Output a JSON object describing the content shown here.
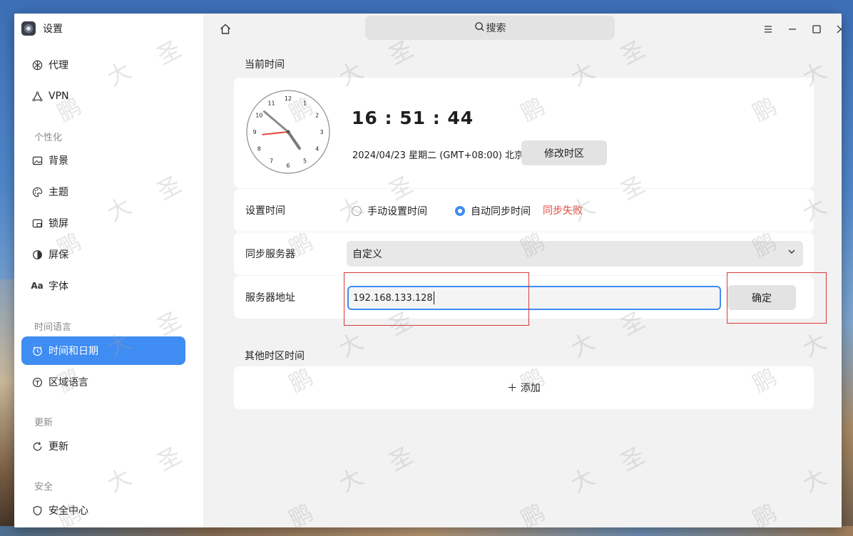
{
  "app": {
    "title": "设置"
  },
  "sidebar": {
    "items": [
      {
        "label": "代理",
        "icon": "proxy-icon"
      },
      {
        "label": "VPN",
        "icon": "vpn-icon"
      },
      {
        "group": "个性化"
      },
      {
        "label": "背景",
        "icon": "wallpaper-icon"
      },
      {
        "label": "主题",
        "icon": "palette-icon"
      },
      {
        "label": "锁屏",
        "icon": "lockscreen-icon"
      },
      {
        "label": "屏保",
        "icon": "screensaver-icon"
      },
      {
        "label": "字体",
        "icon": "font-icon"
      },
      {
        "group": "时间语言"
      },
      {
        "label": "时间和日期",
        "icon": "clock-icon",
        "active": true
      },
      {
        "label": "区域语言",
        "icon": "region-icon"
      },
      {
        "group": "更新"
      },
      {
        "label": "更新",
        "icon": "refresh-icon"
      },
      {
        "group": "安全"
      },
      {
        "label": "安全中心",
        "icon": "shield-icon"
      }
    ]
  },
  "header": {
    "search_placeholder": "搜索"
  },
  "main": {
    "current_time_title": "当前时间",
    "clock": {
      "time": "16 : 51 : 44",
      "date": "2024/04/23 星期二  (GMT+08:00) 北京",
      "change_tz_label": "修改时区",
      "hour": 16,
      "minute": 51,
      "second": 44
    },
    "set_time": {
      "label": "设置时间",
      "manual_label": "手动设置时间",
      "auto_label": "自动同步时间",
      "status": "同步失败",
      "selected": "auto"
    },
    "sync_server": {
      "label": "同步服务器",
      "value": "自定义"
    },
    "server_address": {
      "label": "服务器地址",
      "value": "192.168.133.128",
      "confirm_label": "确定"
    },
    "other_tz_title": "其他时区时间",
    "add_label": "＋  添加"
  },
  "colors": {
    "accent": "#3f8cf2",
    "error": "#e34a3c",
    "highlight_box": "#d63b3b"
  },
  "watermark": [
    "鹏",
    "大",
    "圣"
  ]
}
